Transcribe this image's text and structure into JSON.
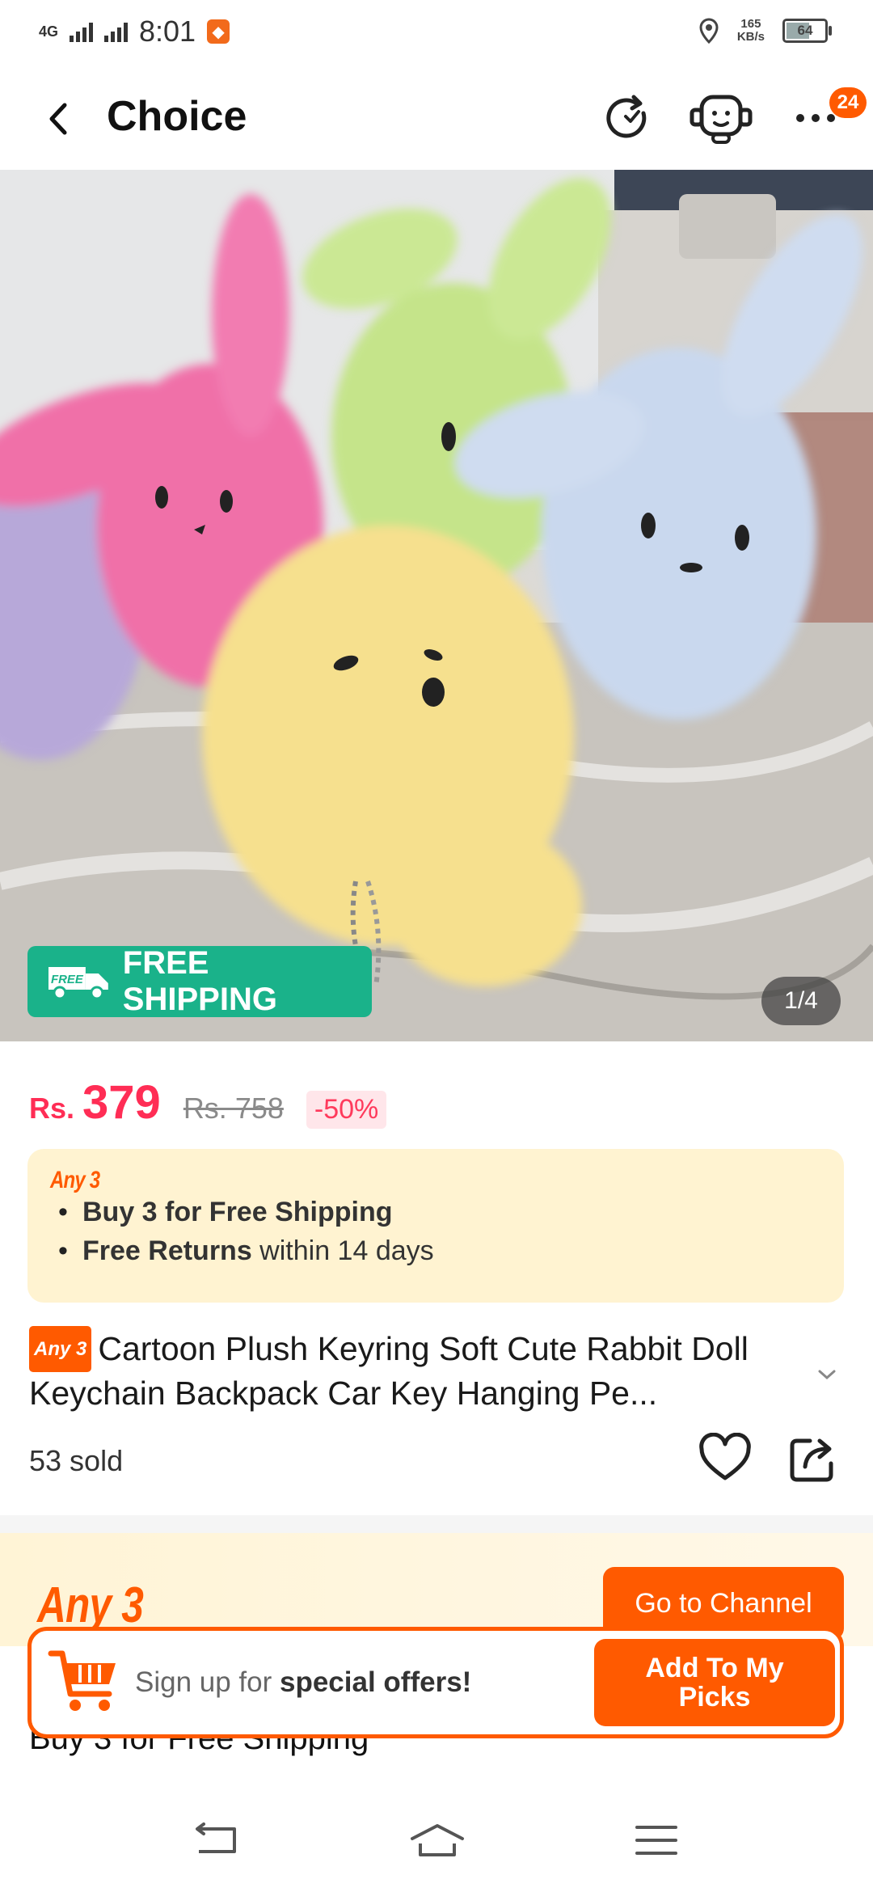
{
  "status_bar": {
    "network": "4G",
    "time": "8:01",
    "speed_value": "165",
    "speed_unit": "KB/s",
    "battery": "64"
  },
  "header": {
    "title": "Choice",
    "cart_count": "24"
  },
  "hero": {
    "free_shipping_tag": "FREE",
    "free_shipping_label": "FREE SHIPPING",
    "image_counter": "1/4",
    "bunny_colors": [
      "#b7a8d9",
      "#f06fa8",
      "#c5e48a",
      "#f6e08e",
      "#c9d8ee"
    ]
  },
  "price": {
    "currency": "Rs.",
    "current": "379",
    "original": "Rs. 758",
    "discount": "-50%"
  },
  "promo": {
    "brand": "Any 3",
    "line1": "Buy 3 for  Free Shipping",
    "line2_bold": "Free Returns",
    "line2_rest": " within 14 days"
  },
  "product": {
    "badge": "Any 3",
    "title": "Cartoon Plush Keyring Soft Cute Rabbit Doll Keychain Backpack Car Key Hanging Pe...",
    "sold": "53 sold"
  },
  "channel": {
    "brand": "Any 3",
    "button": "Go to Channel",
    "subtitle": "Buy 3 for Free Shipping"
  },
  "signup": {
    "text_prefix": "Sign up for ",
    "text_bold": "special offers!",
    "button_line1": "Add To My",
    "button_line2": "Picks"
  },
  "colors": {
    "accent": "#ff5a00",
    "price": "#ff2d55",
    "free_shipping": "#1ab28a"
  }
}
